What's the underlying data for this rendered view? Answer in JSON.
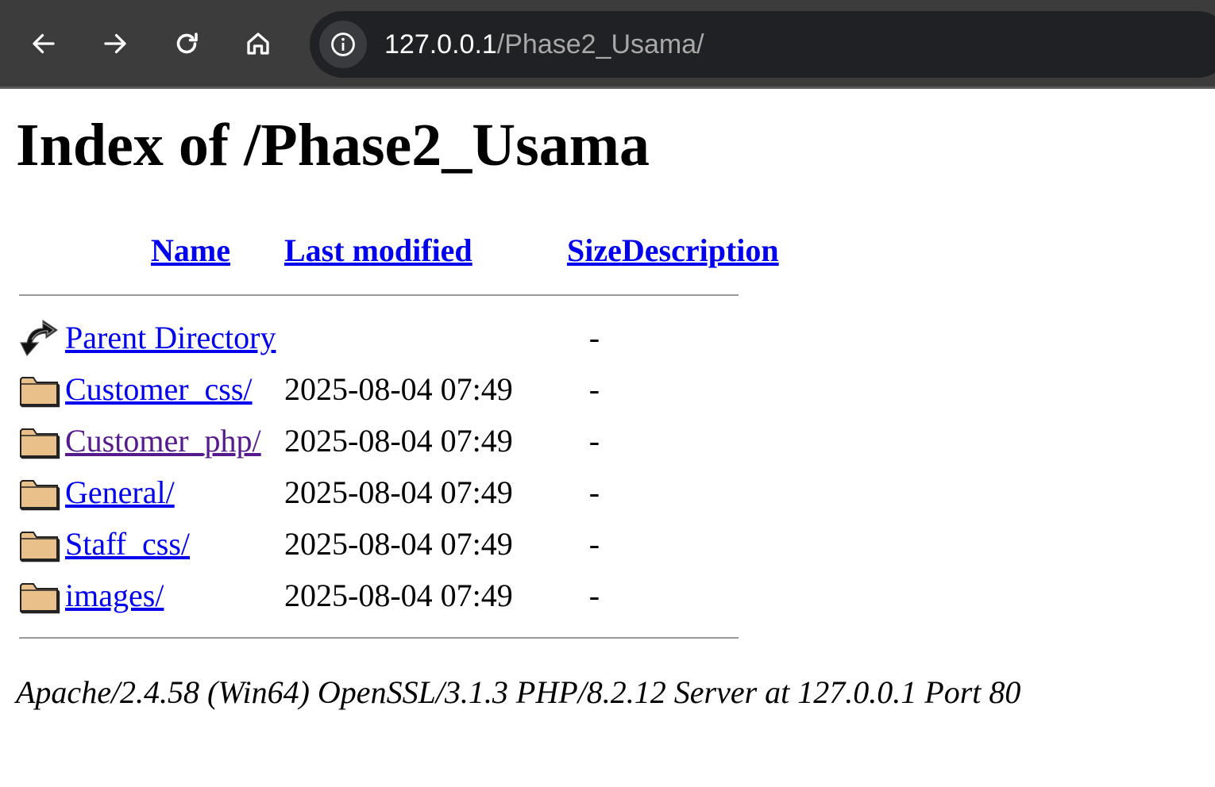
{
  "browser": {
    "url_host": "127.0.0.1",
    "url_path": "/Phase2_Usama/"
  },
  "page": {
    "title": "Index of /Phase2_Usama",
    "columns": {
      "name": "Name",
      "last_modified": "Last modified",
      "size": "Size",
      "description": "Description"
    },
    "parent": {
      "name": "Parent Directory",
      "size": "-",
      "icon": "back-arrow-icon"
    },
    "entries": [
      {
        "name": "Customer_css/",
        "modified": "2025-08-04 07:49",
        "size": "-",
        "icon": "folder-icon"
      },
      {
        "name": "Customer_php/",
        "modified": "2025-08-04 07:49",
        "size": "-",
        "icon": "folder-icon",
        "visited": true
      },
      {
        "name": "General/",
        "modified": "2025-08-04 07:49",
        "size": "-",
        "icon": "folder-icon"
      },
      {
        "name": "Staff_css/",
        "modified": "2025-08-04 07:49",
        "size": "-",
        "icon": "folder-icon"
      },
      {
        "name": "images/",
        "modified": "2025-08-04 07:49",
        "size": "-",
        "icon": "folder-icon"
      }
    ],
    "footer": "Apache/2.4.58 (Win64) OpenSSL/3.1.3 PHP/8.2.12 Server at 127.0.0.1 Port 80"
  },
  "colors": {
    "link": "#0000ee",
    "visited_link": "#551a8b",
    "toolbar_bg": "#3c3c3c",
    "omnibox_bg": "#202124"
  }
}
